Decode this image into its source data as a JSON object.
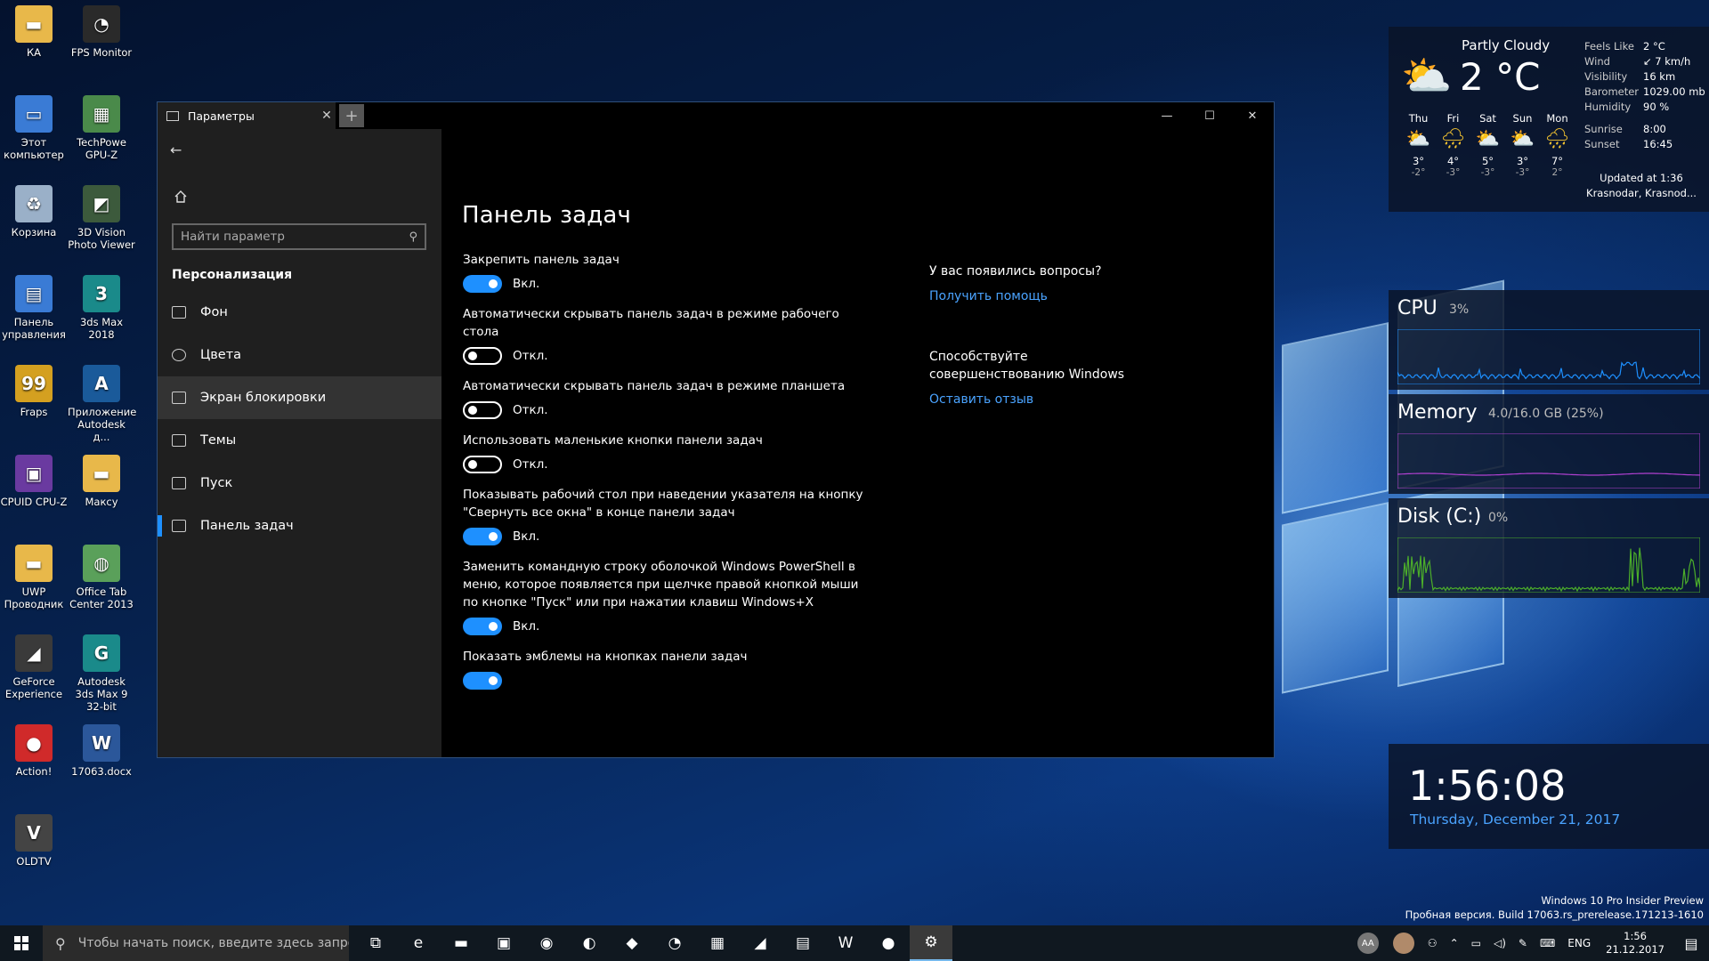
{
  "desktop": {
    "icons": [
      {
        "label": "КА",
        "color": "#e8b84a",
        "glyph": "▬"
      },
      {
        "label": "FPS Monitor",
        "color": "#2a2a2a",
        "glyph": "◔"
      },
      {
        "label": "Этот компьютер",
        "color": "#3a7bd5",
        "glyph": "▭"
      },
      {
        "label": "TechPowe GPU-Z",
        "color": "#4a8a4a",
        "glyph": "▦"
      },
      {
        "label": "Корзина",
        "color": "#9ab0c8",
        "glyph": "♻"
      },
      {
        "label": "3D Vision Photo Viewer",
        "color": "#3c5a3c",
        "glyph": "◩"
      },
      {
        "label": "Панель управления",
        "color": "#3a7bd5",
        "glyph": "▤"
      },
      {
        "label": "3ds Max 2018",
        "color": "#1a8a8a",
        "glyph": "3"
      },
      {
        "label": "Fraps",
        "color": "#d4a020",
        "glyph": "99"
      },
      {
        "label": "Приложение Autodesk д...",
        "color": "#1a5a9a",
        "glyph": "A"
      },
      {
        "label": "CPUID CPU-Z",
        "color": "#6a3aa0",
        "glyph": "▣"
      },
      {
        "label": "Максу",
        "color": "#e8b84a",
        "glyph": "▬"
      },
      {
        "label": "UWP Проводник",
        "color": "#e8b84a",
        "glyph": "▬"
      },
      {
        "label": "Office Tab Center 2013",
        "color": "#5aa05a",
        "glyph": "◍"
      },
      {
        "label": "GeForce Experience",
        "color": "#3a3a3a",
        "glyph": "◢"
      },
      {
        "label": "Autodesk 3ds Max 9 32-bit",
        "color": "#1a8a8a",
        "glyph": "G"
      },
      {
        "label": "Action!",
        "color": "#d02a2a",
        "glyph": "●"
      },
      {
        "label": "17063.docx",
        "color": "#2b579a",
        "glyph": "W"
      },
      {
        "label": "OLDTV",
        "color": "#444",
        "glyph": "V"
      }
    ]
  },
  "window": {
    "tab_title": "Параметры",
    "tab_close": "✕",
    "new_tab": "+",
    "minimize": "—",
    "maximize": "☐",
    "close": "✕"
  },
  "sidebar": {
    "back": "←",
    "search_placeholder": "Найти параметр",
    "section": "Персонализация",
    "items": [
      {
        "label": "Фон"
      },
      {
        "label": "Цвета"
      },
      {
        "label": "Экран блокировки"
      },
      {
        "label": "Темы"
      },
      {
        "label": "Пуск"
      },
      {
        "label": "Панель задач"
      }
    ]
  },
  "content": {
    "title": "Панель задач",
    "settings": [
      {
        "label": "Закрепить панель задач",
        "state": "Вкл.",
        "on": true
      },
      {
        "label": "Автоматически скрывать панель задач в режиме рабочего стола",
        "state": "Откл.",
        "on": false
      },
      {
        "label": "Автоматически скрывать панель задач в режиме планшета",
        "state": "Откл.",
        "on": false
      },
      {
        "label": "Использовать маленькие кнопки панели задач",
        "state": "Откл.",
        "on": false
      },
      {
        "label": "Показывать рабочий стол при наведении указателя на кнопку \"Свернуть все окна\" в конце панели задач",
        "state": "Вкл.",
        "on": true
      },
      {
        "label": "Заменить командную строку оболочкой Windows PowerShell в меню, которое появляется при щелчке правой кнопкой мыши по кнопке \"Пуск\" или при нажатии клавиш Windows+X",
        "state": "Вкл.",
        "on": true
      },
      {
        "label": "Показать эмблемы на кнопках панели задач",
        "state": "",
        "on": true
      }
    ],
    "help": {
      "q_title": "У вас появились вопросы?",
      "q_link": "Получить помощь",
      "fb_title": "Способствуйте совершенствованию Windows",
      "fb_link": "Оставить отзыв"
    }
  },
  "weather": {
    "condition": "Partly Cloudy",
    "temp": "2 °C",
    "details": [
      {
        "k": "Feels Like",
        "v": "2 °C"
      },
      {
        "k": "Wind",
        "v": "↙ 7 km/h"
      },
      {
        "k": "Visibility",
        "v": "16 km"
      },
      {
        "k": "Barometer",
        "v": "1029.00 mb"
      },
      {
        "k": "Humidity",
        "v": "90 %"
      }
    ],
    "sun": [
      {
        "k": "Sunrise",
        "v": "8:00"
      },
      {
        "k": "Sunset",
        "v": "16:45"
      }
    ],
    "forecast": [
      {
        "day": "Thu",
        "icon": "⛅",
        "hi": "3°",
        "lo": "-2°"
      },
      {
        "day": "Fri",
        "icon": "🌧",
        "hi": "4°",
        "lo": "-3°"
      },
      {
        "day": "Sat",
        "icon": "⛅",
        "hi": "5°",
        "lo": "-3°"
      },
      {
        "day": "Sun",
        "icon": "⛅",
        "hi": "3°",
        "lo": "-3°"
      },
      {
        "day": "Mon",
        "icon": "🌧",
        "hi": "7°",
        "lo": "2°"
      }
    ],
    "updated": "Updated at 1:36",
    "location": "Krasnodar, Krasnod..."
  },
  "perf": {
    "cpu": {
      "title": "CPU",
      "value": "3%",
      "color": "#1e90ff"
    },
    "memory": {
      "title": "Memory",
      "value": "4.0/16.0 GB (25%)",
      "color": "#b040d0"
    },
    "disk": {
      "title": "Disk (C:)",
      "value": "0%",
      "color": "#4caf2a"
    }
  },
  "clock": {
    "time": "1:56:08",
    "date": "Thursday, December 21, 2017"
  },
  "watermark": {
    "line1": "Windows 10 Pro Insider Preview",
    "line2": "Пробная версия. Build 17063.rs_prerelease.171213-1610"
  },
  "taskbar": {
    "search_placeholder": "Чтобы начать поиск, введите здесь запрос",
    "apps": [
      {
        "name": "task-view",
        "glyph": "⧉"
      },
      {
        "name": "edge",
        "glyph": "e"
      },
      {
        "name": "explorer",
        "glyph": "▬"
      },
      {
        "name": "store",
        "glyph": "▣"
      },
      {
        "name": "chrome",
        "glyph": "◉"
      },
      {
        "name": "steam",
        "glyph": "◐"
      },
      {
        "name": "maps",
        "glyph": "◆"
      },
      {
        "name": "fps-monitor",
        "glyph": "◔"
      },
      {
        "name": "cpu-z",
        "glyph": "▦"
      },
      {
        "name": "folder-app",
        "glyph": "◢"
      },
      {
        "name": "gpu-z",
        "glyph": "▤"
      },
      {
        "name": "word",
        "glyph": "W"
      },
      {
        "name": "action",
        "glyph": "●"
      },
      {
        "name": "settings",
        "glyph": "⚙"
      }
    ],
    "tray": {
      "avatar1": "AA",
      "lang": "ENG",
      "time": "1:56",
      "date": "21.12.2017"
    }
  }
}
